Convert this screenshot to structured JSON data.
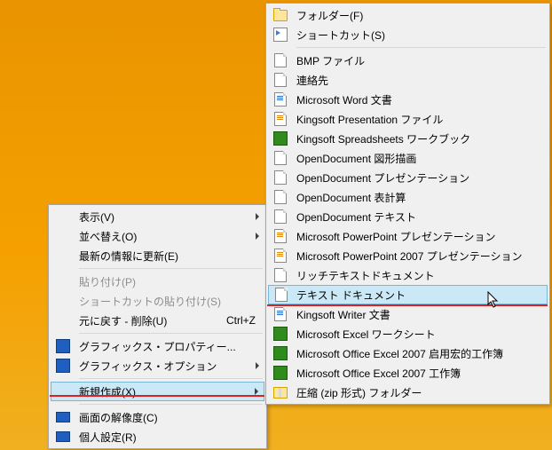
{
  "context_menu": {
    "items": [
      {
        "label": "表示(V)",
        "submenu": true
      },
      {
        "label": "並べ替え(O)",
        "submenu": true
      },
      {
        "label": "最新の情報に更新(E)"
      },
      {
        "sep": true
      },
      {
        "label": "貼り付け(P)",
        "disabled": true
      },
      {
        "label": "ショートカットの貼り付け(S)",
        "disabled": true
      },
      {
        "label": "元に戻す - 削除(U)",
        "shortcut": "Ctrl+Z"
      },
      {
        "sep": true
      },
      {
        "label": "グラフィックス・プロパティー...",
        "icon": "blue-square"
      },
      {
        "label": "グラフィックス・オプション",
        "icon": "blue-square",
        "submenu": true
      },
      {
        "sep": true
      },
      {
        "label": "新規作成(X)",
        "submenu": true,
        "highlight": true
      },
      {
        "sep": true
      },
      {
        "label": "画面の解像度(C)",
        "icon": "monitor"
      },
      {
        "label": "個人設定(R)",
        "icon": "monitor"
      }
    ]
  },
  "new_submenu": {
    "items": [
      {
        "label": "フォルダー(F)",
        "icon": "folder"
      },
      {
        "label": "ショートカット(S)",
        "icon": "shortcut"
      },
      {
        "sep": true
      },
      {
        "label": "BMP ファイル",
        "icon": "page"
      },
      {
        "label": "連絡先",
        "icon": "contact"
      },
      {
        "label": "Microsoft Word 文書",
        "icon": "page-blue"
      },
      {
        "label": "Kingsoft Presentation ファイル",
        "icon": "page-red"
      },
      {
        "label": "Kingsoft Spreadsheets ワークブック",
        "icon": "green"
      },
      {
        "label": "OpenDocument 図形描画",
        "icon": "page"
      },
      {
        "label": "OpenDocument プレゼンテーション",
        "icon": "page"
      },
      {
        "label": "OpenDocument 表計算",
        "icon": "page"
      },
      {
        "label": "OpenDocument テキスト",
        "icon": "page"
      },
      {
        "label": "Microsoft PowerPoint プレゼンテーション",
        "icon": "page-orange"
      },
      {
        "label": "Microsoft PowerPoint 2007 プレゼンテーション",
        "icon": "page-orange"
      },
      {
        "label": "リッチテキストドキュメント",
        "icon": "page"
      },
      {
        "label": "テキスト ドキュメント",
        "icon": "page",
        "highlight": true
      },
      {
        "label": "Kingsoft Writer 文書",
        "icon": "page-blue"
      },
      {
        "label": "Microsoft Excel ワークシート",
        "icon": "green"
      },
      {
        "label": "Microsoft Office Excel 2007 启用宏的工作簿",
        "icon": "green"
      },
      {
        "label": "Microsoft Office Excel 2007 工作簿",
        "icon": "green"
      },
      {
        "label": "圧縮 (zip 形式) フォルダー",
        "icon": "zip"
      }
    ]
  }
}
